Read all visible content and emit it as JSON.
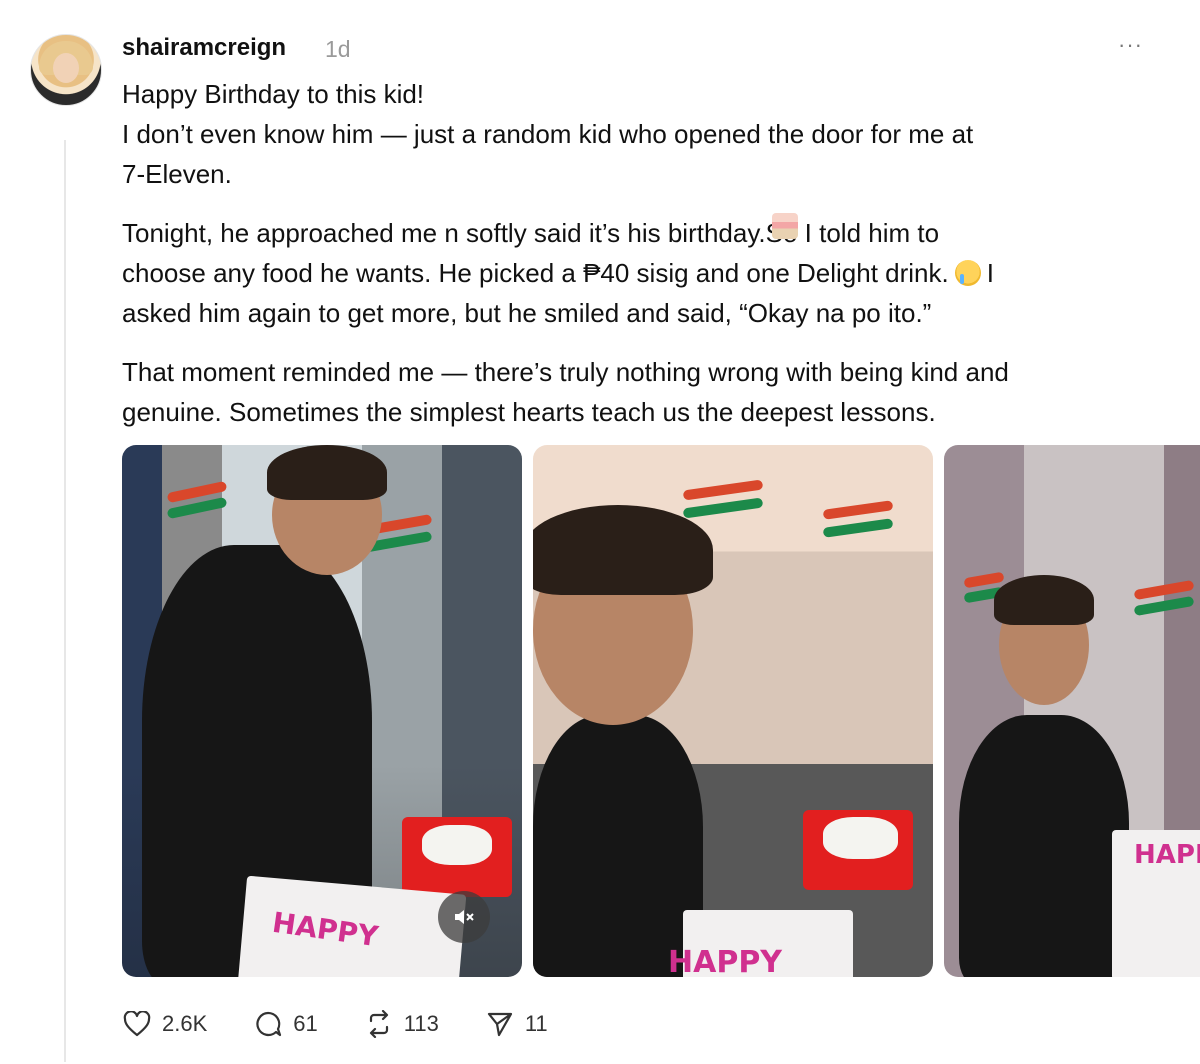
{
  "post": {
    "username": "shairamcreign",
    "time": "1d",
    "more": "···",
    "lines": {
      "p1l1": "Happy Birthday to this kid!",
      "p1l2": "I don’t even know him — just a random kid who opened the door for me at",
      "p1l3": "7-Eleven.",
      "p2a": "Tonight, he approached me n softly said it’s his birthday.",
      "p2b": "So I told him to",
      "p2c": "choose any food he wants. He picked a ₱40 sisig and one Delight drink.",
      "p2d": "I",
      "p2e": "asked him again to get more, but he smiled and said, “Okay na po ito.”",
      "p3l1": "That moment reminded me — there’s truly nothing wrong with being kind and",
      "p3l2": "genuine. Sometimes the simplest hearts teach us the deepest lessons."
    },
    "emojis": [
      "birthday-cake",
      "crying-face"
    ]
  },
  "photos": {
    "p1_cake": "HAPPY",
    "p2_cake": "HAPPY",
    "p3_cake": "HAPP"
  },
  "actions": {
    "likes": "2.6K",
    "replies": "61",
    "reposts": "113",
    "shares": "11"
  },
  "colors": {
    "text": "#111111",
    "muted": "#9a9a9a",
    "icon": "#333333"
  }
}
